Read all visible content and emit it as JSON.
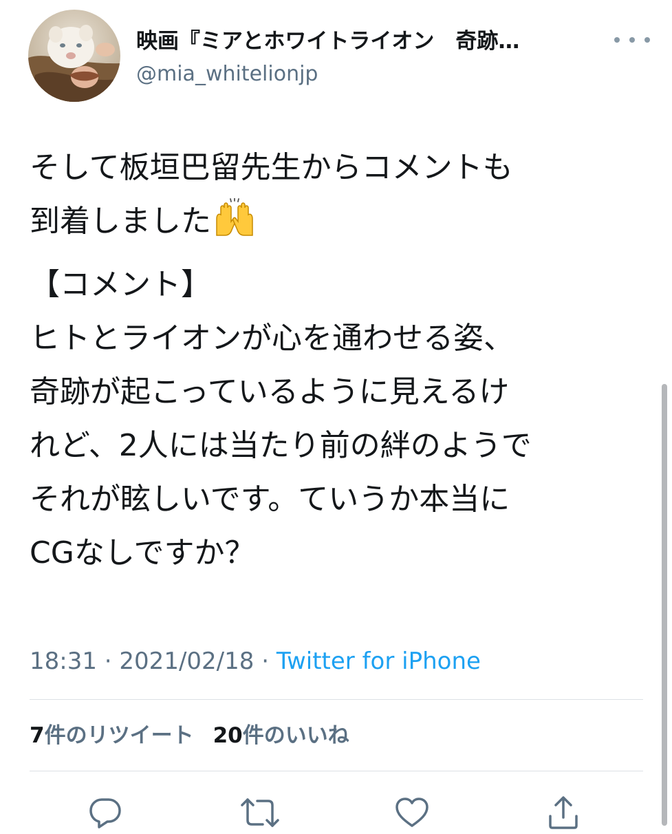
{
  "header": {
    "display_name": "映画『ミアとホワイトライオン　奇跡…",
    "handle": "@mia_whitelionjp",
    "avatar_alt": "avatar"
  },
  "tweet": {
    "lines_p1": [
      "そして板垣巴留先生からコメントも",
      "到着しました"
    ],
    "emoji": "raising-hands",
    "lines_p2": [
      "【コメント】",
      "ヒトとライオンが心を通わせる姿、",
      "奇跡が起こっているように見えるけ",
      "れど、2人には当たり前の絆のようで",
      "それが眩しいです。ていうか本当に",
      "CGなしですか？"
    ]
  },
  "meta": {
    "time": "18:31",
    "sep1": " · ",
    "date": "2021/02/18",
    "sep2": " · ",
    "source": "Twitter for iPhone"
  },
  "stats": {
    "retweets_count": "7",
    "retweets_label": "件のリツイート",
    "likes_count": "20",
    "likes_label": "件のいいね"
  },
  "actions": {
    "reply_icon": "reply-icon",
    "retweet_icon": "retweet-icon",
    "like_icon": "heart-icon",
    "share_icon": "share-icon"
  },
  "colors": {
    "text_primary": "#14171a",
    "text_secondary": "#5b7083",
    "link": "#1da1f2",
    "divider": "#dce1e5",
    "icon": "#5b7083"
  }
}
